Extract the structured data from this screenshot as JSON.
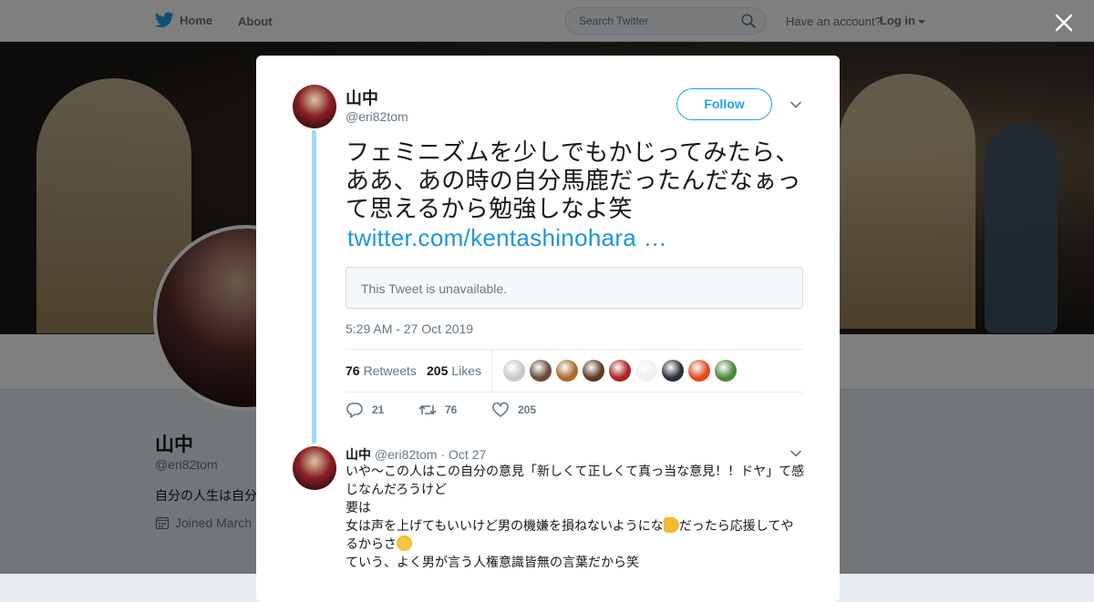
{
  "topbar": {
    "home_label": "Home",
    "about_label": "About",
    "search_placeholder": "Search Twitter",
    "account_question": "Have an account?",
    "login_label": "Log in"
  },
  "background_profile": {
    "name": "山中",
    "handle": "@eri82tom",
    "bio": "自分の人生は自分",
    "joined": "Joined March"
  },
  "modal": {
    "author": {
      "name": "山中",
      "handle": "@eri82tom"
    },
    "follow_label": "Follow",
    "tweet_text": "フェミニズムを少しでもかじってみたら、ああ、あの時の自分馬鹿だったんだなぁって思えるから勉強しなよ笑",
    "tweet_link": "twitter.com/kentashinohara …",
    "quoted_unavailable": "This Tweet is unavailable.",
    "timestamp": "5:29 AM - 27 Oct 2019",
    "stats": {
      "retweets_count": "76",
      "retweets_label": "Retweets",
      "likes_count": "205",
      "likes_label": "Likes"
    },
    "likers": [
      {
        "color": "#c9c9c9"
      },
      {
        "color": "#6b4a3a"
      },
      {
        "color": "#a86a2a"
      },
      {
        "color": "#5a3a22"
      },
      {
        "color": "#b02020"
      },
      {
        "color": "#f0f0f0"
      },
      {
        "color": "#2a2f3a"
      },
      {
        "color": "#e04a1a"
      },
      {
        "color": "#4a8a3a"
      }
    ],
    "actions": {
      "replies": "21",
      "retweets": "76",
      "likes": "205"
    },
    "reply": {
      "name": "山中",
      "handle": "@eri82tom",
      "date": "· Oct 27",
      "lines": [
        "いや〜この人はこの自分の意見「新しくて正しくて真っ当な意見！！ドヤ」て感じなんだろうけど",
        "要は",
        "女は声を上げてもいいけど男の機嫌を損ねないようにな",
        "だったら応援してやるからさ",
        "ていう、よく男が言う人権意識皆無の言葉だから笑"
      ]
    }
  }
}
